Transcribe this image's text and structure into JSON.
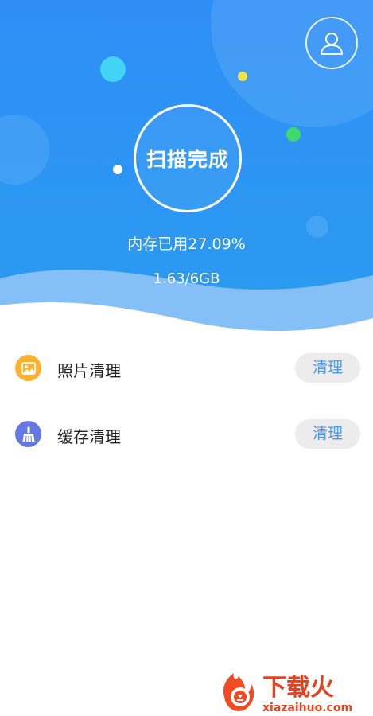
{
  "header": {
    "scan_status": "扫描完成",
    "memory_usage_text": "内存已用27.09%",
    "memory_usage_percent": 27.09,
    "memory_size_text": "1.63/6GB"
  },
  "avatar": {
    "icon": "user-icon"
  },
  "list": {
    "items": [
      {
        "label": "照片清理",
        "button_label": "清理",
        "icon": "image-icon",
        "icon_color": "#fbb02e"
      },
      {
        "label": "缓存清理",
        "button_label": "清理",
        "icon": "broom-icon",
        "icon_color": "#6378e3"
      }
    ]
  },
  "watermark": {
    "brand_text": "下载火",
    "site_text": "xiazaihuo.com"
  },
  "colors": {
    "header_gradient_top": "#2c8ff5",
    "header_gradient_bottom": "#2b9af0",
    "accent": "#4a97f2",
    "button_bg": "#ececec"
  }
}
